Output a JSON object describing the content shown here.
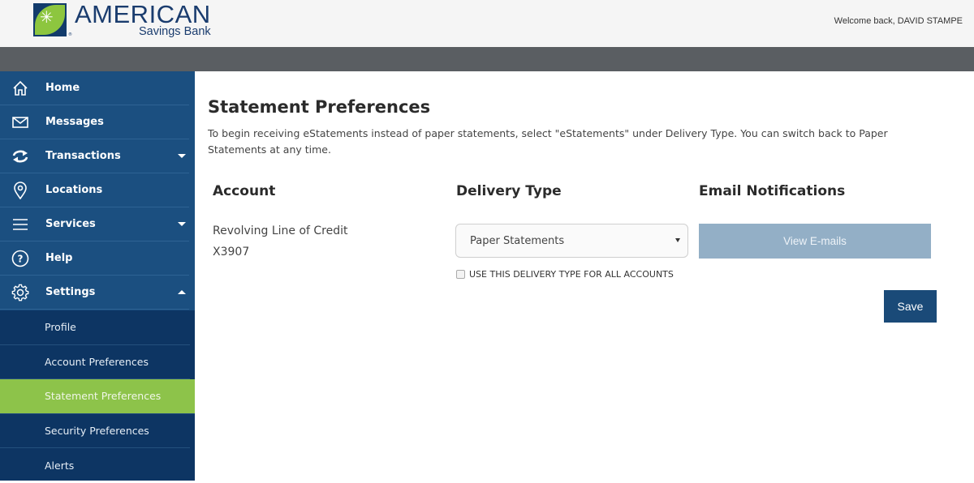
{
  "header": {
    "brand_name": "AMERICAN",
    "brand_sub": "Savings Bank",
    "brand_reg": "®",
    "welcome": "Welcome back, DAVID STAMPE"
  },
  "sidebar": {
    "items": [
      {
        "label": "Home",
        "icon": "home-icon"
      },
      {
        "label": "Messages",
        "icon": "envelope-icon"
      },
      {
        "label": "Transactions",
        "icon": "transfer-icon",
        "caret": "down"
      },
      {
        "label": "Locations",
        "icon": "map-pin-icon"
      },
      {
        "label": "Services",
        "icon": "menu-icon",
        "caret": "down"
      },
      {
        "label": "Help",
        "icon": "help-icon"
      },
      {
        "label": "Settings",
        "icon": "gear-icon",
        "caret": "up"
      }
    ],
    "sub_items": [
      {
        "label": "Profile"
      },
      {
        "label": "Account Preferences"
      },
      {
        "label": "Statement Preferences",
        "active": true
      },
      {
        "label": "Security Preferences"
      },
      {
        "label": "Alerts"
      }
    ]
  },
  "main": {
    "title": "Statement Preferences",
    "intro": "To begin receiving eStatements instead of paper statements, select \"eStatements\" under Delivery Type. You can switch back to Paper Statements at any time.",
    "columns": {
      "account": "Account",
      "delivery": "Delivery Type",
      "email": "Email Notifications"
    },
    "account": {
      "name": "Revolving Line of Credit",
      "number": "X3907"
    },
    "delivery_select": {
      "value": "Paper Statements"
    },
    "apply_all_label": "USE THIS DELIVERY TYPE FOR ALL ACCOUNTS",
    "apply_all_checked": false,
    "view_emails_label": "View E-mails",
    "save_label": "Save"
  },
  "colors": {
    "sidebar": "#1b4f80",
    "submenu": "#0d3563",
    "active_green": "#8dc34a",
    "primary_button": "#1a4a78",
    "disabled_button": "#93afc6"
  }
}
